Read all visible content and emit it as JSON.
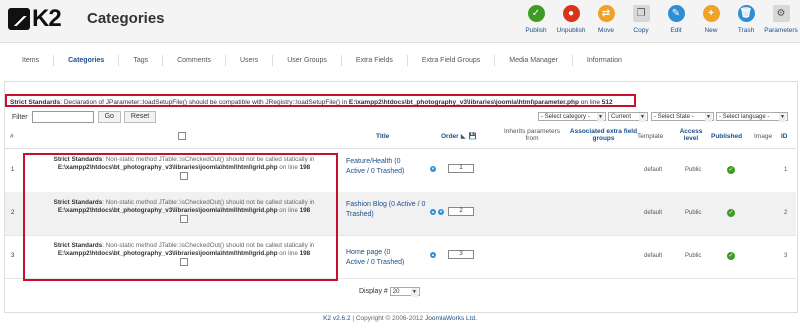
{
  "app": {
    "logo_text": "K2",
    "title": "Categories"
  },
  "toolbar": [
    {
      "label": "Publish",
      "icon": "publish-icon",
      "color": "#3f9a26",
      "glyph": "✓"
    },
    {
      "label": "Unpublish",
      "icon": "unpublish-icon",
      "color": "#d9331c",
      "glyph": "●"
    },
    {
      "label": "Move",
      "icon": "move-icon",
      "color": "#f2a127",
      "glyph": "⇄"
    },
    {
      "label": "Copy",
      "icon": "copy-icon",
      "color": "#d8d8d8",
      "glyph": "❐"
    },
    {
      "label": "Edit",
      "icon": "edit-icon",
      "color": "#2f8fd4",
      "glyph": "✎"
    },
    {
      "label": "New",
      "icon": "new-icon",
      "color": "#f2a127",
      "glyph": "+"
    },
    {
      "label": "Trash",
      "icon": "trash-icon",
      "color": "#2f8fd4",
      "glyph": "🗑"
    },
    {
      "label": "Parameters",
      "icon": "parameters-icon",
      "color": "#d8d8d8",
      "glyph": "⚙"
    }
  ],
  "nav": {
    "items": [
      "Items",
      "Categories",
      "Tags",
      "Comments",
      "Users",
      "User Groups",
      "Extra Fields",
      "Extra Field Groups",
      "Media Manager",
      "Information"
    ],
    "active": 1
  },
  "strict": {
    "label": "Strict Standards",
    "text": ": Declaration of JParameter::loadSetupFile() should be compatible with JRegistry::loadSetupFile() in ",
    "file": "E:\\xampp2\\htdocs\\bt_photography_v3\\libraries\\joomla\\html\\parameter.php",
    "line_text": " on line ",
    "line": "512"
  },
  "filter": {
    "label": "Filter",
    "go": "Go",
    "reset": "Reset",
    "value": ""
  },
  "selects": {
    "category": "- Select category -",
    "current": "Current",
    "state": "- Select State -",
    "language": "- Select language -"
  },
  "table": {
    "headers": {
      "num": "#",
      "title": "Title",
      "order": "Order",
      "inherits": "Inherits parameters from",
      "assoc": "Associated extra field groups",
      "template": "Template",
      "access": "Access level",
      "published": "Published",
      "image": "Image",
      "id": "ID"
    }
  },
  "rows": [
    {
      "num": "1",
      "title": "Feature/Health (0 Active / 0 Trashed)",
      "order": "1",
      "template": "default",
      "access": "Public",
      "id": "1",
      "arrows": [
        "down"
      ]
    },
    {
      "num": "2",
      "title": "Fashion Blog (0 Active / 0 Trashed)",
      "order": "2",
      "template": "default",
      "access": "Public",
      "id": "2",
      "arrows": [
        "up",
        "down"
      ]
    },
    {
      "num": "3",
      "title": "Home page (0 Active / 0 Trashed)",
      "order": "3",
      "template": "default",
      "access": "Public",
      "id": "3",
      "arrows": [
        "up"
      ]
    }
  ],
  "row_error": {
    "label": "Strict Standards",
    "text": ": Non-static method JTable::isCheckedOut() should not be called statically in ",
    "file": "E:\\xampp2\\htdocs\\bt_photography_v3\\libraries\\joomla\\html\\html\\grid.php",
    "line_text": " on line ",
    "line": "198"
  },
  "display": {
    "label": "Display #",
    "value": "20"
  },
  "footer": {
    "version": "K2 v2.6.2",
    "copy": " | Copyright © 2006-2012 ",
    "company": "JoomlaWorks Ltd."
  }
}
